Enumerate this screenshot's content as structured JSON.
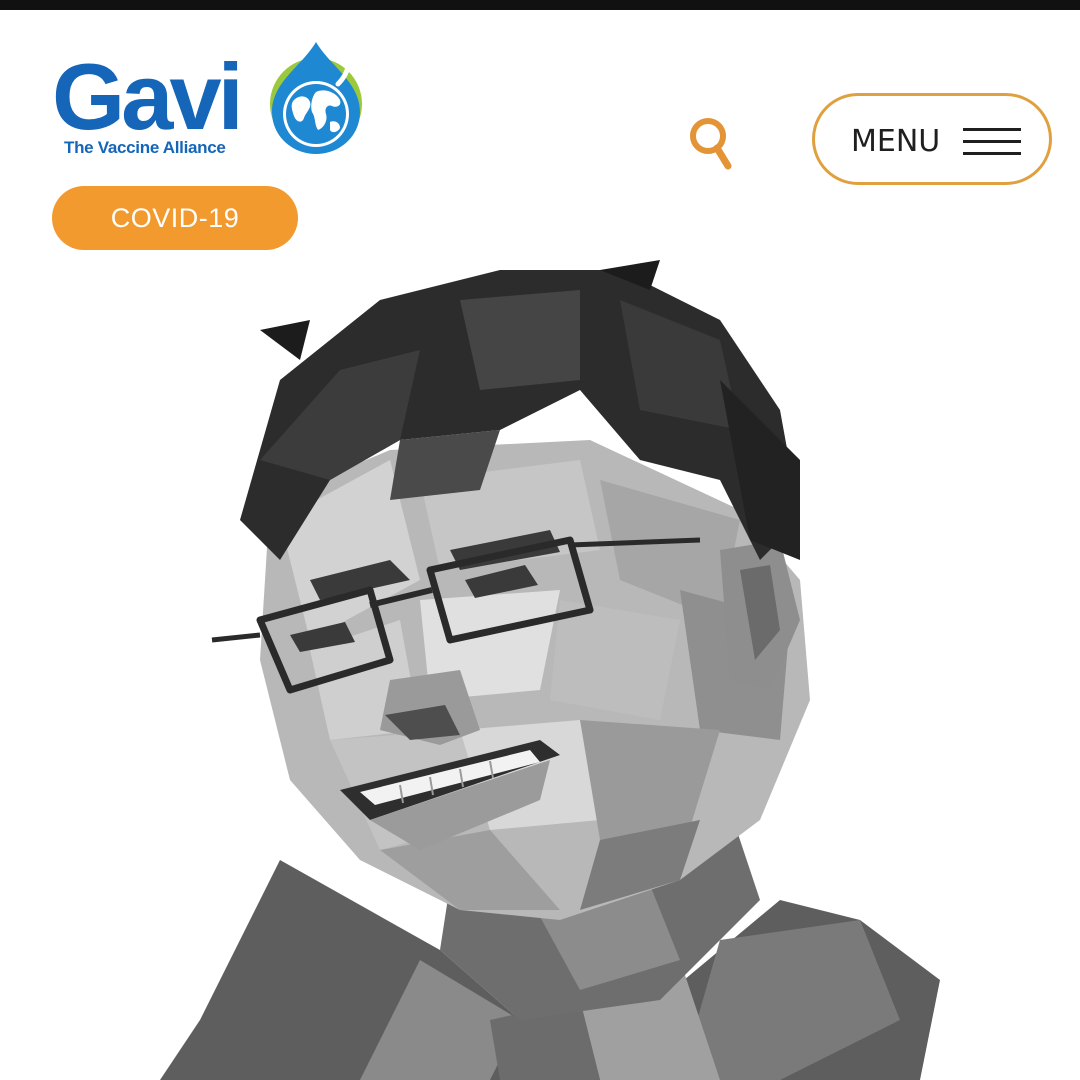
{
  "header": {
    "logo": {
      "word": "Gavi",
      "tagline": "The Vaccine Alliance",
      "icon": "globe-water-drop-icon"
    },
    "covid_label": "COVID-19",
    "search_icon": "search-icon",
    "menu_label": "MENU",
    "menu_icon": "hamburger-icon"
  },
  "hero": {
    "image": "grayscale-low-poly-portrait"
  },
  "colors": {
    "brand_blue": "#1565b8",
    "drop_blue": "#1e88d2",
    "drop_green": "#9bc83c",
    "accent_orange": "#f29a2e",
    "menu_border": "#e0a040",
    "top_bar": "#111111"
  }
}
